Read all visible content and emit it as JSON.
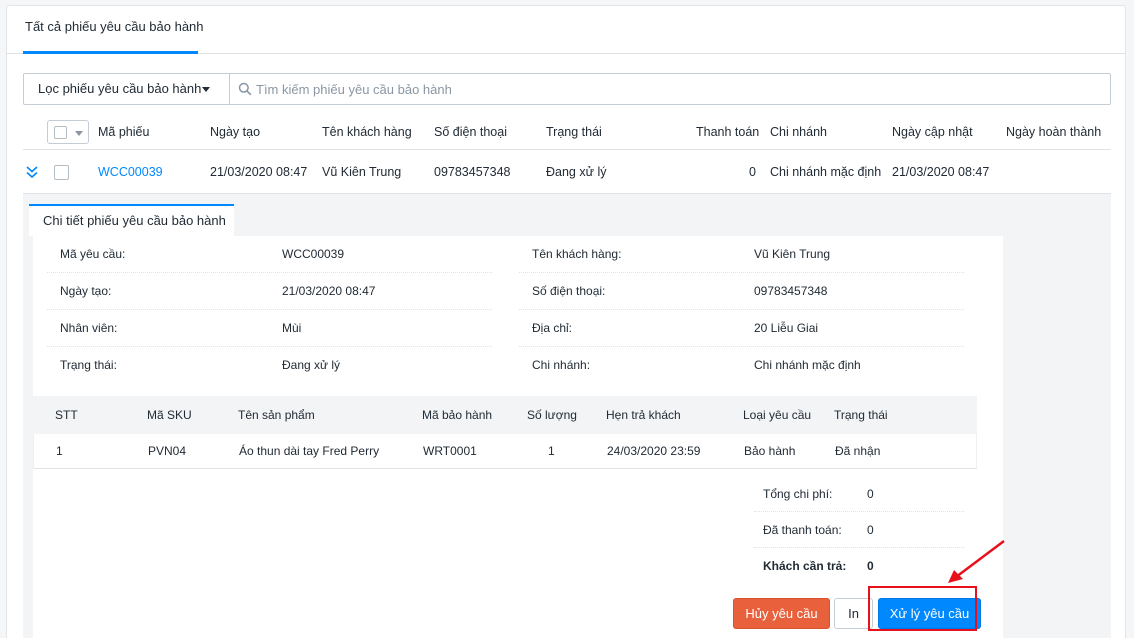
{
  "tabs": {
    "main": "Tất cả phiếu yêu cầu bảo hành"
  },
  "filter": {
    "label": "Lọc phiếu yêu cầu bảo hành",
    "search_placeholder": "Tìm kiếm phiếu yêu cầu bảo hành"
  },
  "table": {
    "columns": [
      "Mã phiếu",
      "Ngày tạo",
      "Tên khách hàng",
      "Số điện thoại",
      "Trạng thái",
      "Thanh toán",
      "Chi nhánh",
      "Ngày cập nhật",
      "Ngày hoàn thành"
    ],
    "rows": [
      {
        "code": "WCC00039",
        "created": "21/03/2020 08:47",
        "customer": "Vũ Kiên Trung",
        "phone": "09783457348",
        "status": "Đang xử lý",
        "payment": "0",
        "branch": "Chi nhánh mặc định",
        "updated": "21/03/2020 08:47",
        "completed": ""
      }
    ]
  },
  "detail": {
    "tab": "Chi tiết phiếu yêu cầu bảo hành",
    "left": [
      {
        "label": "Mã yêu cầu:",
        "value": "WCC00039"
      },
      {
        "label": "Ngày tạo:",
        "value": "21/03/2020 08:47"
      },
      {
        "label": "Nhân viên:",
        "value": "Mùi"
      },
      {
        "label": "Trạng thái:",
        "value": "Đang xử lý"
      }
    ],
    "right": [
      {
        "label": "Tên khách hàng:",
        "value": "Vũ Kiên Trung"
      },
      {
        "label": "Số điện thoại:",
        "value": "09783457348"
      },
      {
        "label": "Địa chỉ:",
        "value": "20 Liễu Giai"
      },
      {
        "label": "Chi nhánh:",
        "value": "Chi nhánh mặc định"
      }
    ],
    "items_columns": [
      "STT",
      "Mã SKU",
      "Tên sản phẩm",
      "Mã bảo hành",
      "Số lượng",
      "Hẹn trả khách",
      "Loại yêu cầu",
      "Trạng thái"
    ],
    "items": [
      {
        "stt": "1",
        "sku": "PVN04",
        "name": "Áo thun dài tay Fred Perry",
        "warranty_code": "WRT0001",
        "qty": "1",
        "return_date": "24/03/2020 23:59",
        "type": "Bảo hành",
        "status": "Đã nhận"
      }
    ],
    "summary": [
      {
        "label": "Tổng chi phí:",
        "value": "0"
      },
      {
        "label": "Đã thanh toán:",
        "value": "0"
      },
      {
        "label": "Khách cần trả:",
        "value": "0"
      }
    ],
    "buttons": {
      "cancel": "Hủy yêu cầu",
      "print": "In",
      "process": "Xử lý yêu cầu"
    }
  },
  "colors": {
    "accent": "#0088ff",
    "danger": "#e8603c",
    "annotation": "#e8101b"
  }
}
